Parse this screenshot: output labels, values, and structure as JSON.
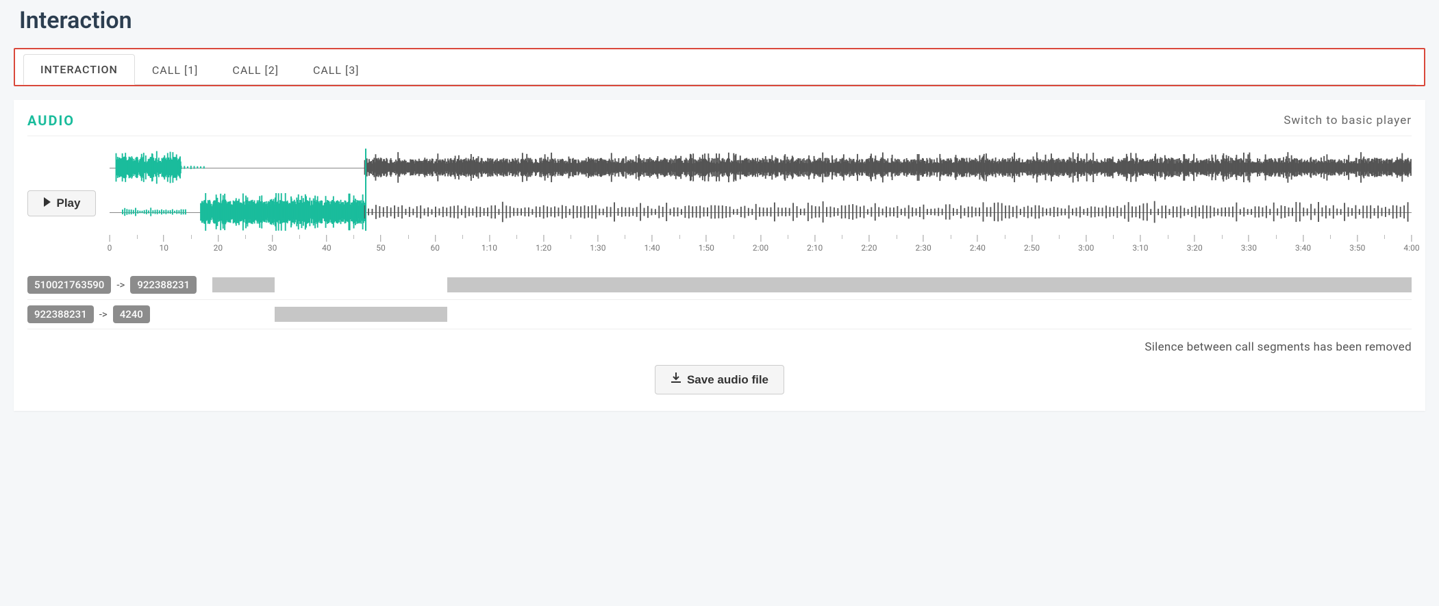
{
  "page_title": "Interaction",
  "tabs": [
    {
      "label": "INTERACTION",
      "active": true
    },
    {
      "label": "CALL [1]",
      "active": false
    },
    {
      "label": "CALL [2]",
      "active": false
    },
    {
      "label": "CALL [3]",
      "active": false
    }
  ],
  "audio": {
    "title": "AUDIO",
    "switch_link": "Switch to basic player",
    "play_label": "Play",
    "save_label": "Save audio file",
    "silence_note": "Silence between call segments has been removed",
    "timeline_labels": [
      "0",
      "10",
      "20",
      "30",
      "40",
      "50",
      "60",
      "1:10",
      "1:20",
      "1:30",
      "1:40",
      "1:50",
      "2:00",
      "2:10",
      "2:20",
      "2:30",
      "2:40",
      "2:50",
      "3:00",
      "3:10",
      "3:20",
      "3:30",
      "3:40",
      "3:50",
      "4:00"
    ],
    "playhead_pct": 19.6,
    "segments": [
      {
        "from": "510021763590",
        "to": "922388231",
        "bars": [
          {
            "left_pct": 0,
            "width_pct": 5.2
          },
          {
            "left_pct": 19.6,
            "width_pct": 80.4
          }
        ]
      },
      {
        "from": "922388231",
        "to": "4240",
        "bars": [
          {
            "left_pct": 5.2,
            "width_pct": 14.4
          }
        ]
      }
    ]
  }
}
